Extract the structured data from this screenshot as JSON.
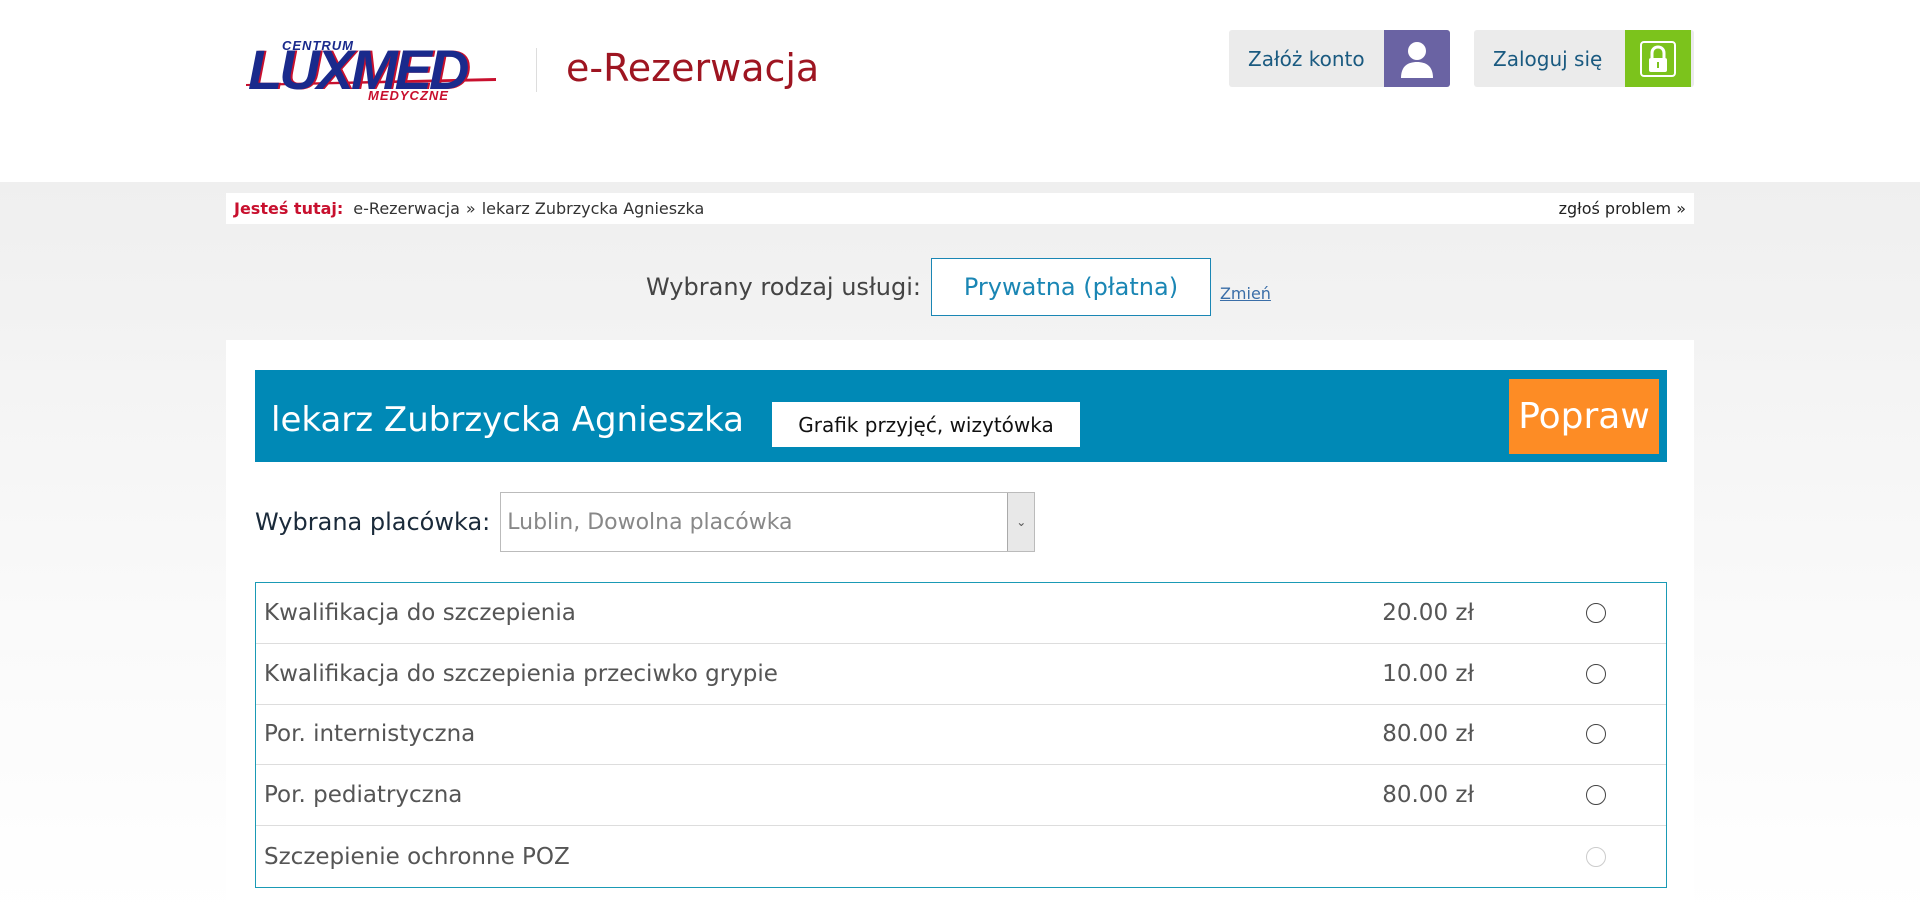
{
  "header": {
    "logo": {
      "top": "CENTRUM",
      "main": "LUXMED",
      "bottom": "MEDYCZNE"
    },
    "app_title": "e-Rezerwacja",
    "register_label": "Załóż konto",
    "login_label": "Zaloguj się"
  },
  "breadcrumb": {
    "here_label": "Jesteś tutaj:",
    "items": [
      "e-Rezerwacja",
      "lekarz Zubrzycka Agnieszka"
    ],
    "separator": "»",
    "report_label": "zgłoś problem »"
  },
  "service_type": {
    "label": "Wybrany rodzaj usługi:",
    "value": "Prywatna (płatna)",
    "change_label": "Zmień"
  },
  "doctor": {
    "name": "lekarz Zubrzycka Agnieszka",
    "schedule_label": "Grafik przyjęć, wizytówka",
    "fix_label": "Popraw"
  },
  "facility": {
    "label": "Wybrana placówka:",
    "placeholder": "Lublin, Dowolna placówka"
  },
  "services": [
    {
      "name": "Kwalifikacja do szczepienia",
      "price": "20.00 zł",
      "disabled": false
    },
    {
      "name": "Kwalifikacja do szczepienia przeciwko grypie",
      "price": "10.00 zł",
      "disabled": false
    },
    {
      "name": "Por. internistyczna",
      "price": "80.00 zł",
      "disabled": false
    },
    {
      "name": "Por. pediatryczna",
      "price": "80.00 zł",
      "disabled": false
    },
    {
      "name": "Szczepienie ochronne POZ",
      "price": "",
      "disabled": true
    }
  ],
  "colors": {
    "brand_red": "#9e1521",
    "brand_blue": "#0089b6",
    "accent_orange": "#fd8c25",
    "register_icon_bg": "#6a63a3",
    "login_icon_bg": "#7cc31c"
  },
  "icons": {
    "register": "user-icon",
    "login": "lock-icon",
    "select": "chevron-down-icon"
  }
}
